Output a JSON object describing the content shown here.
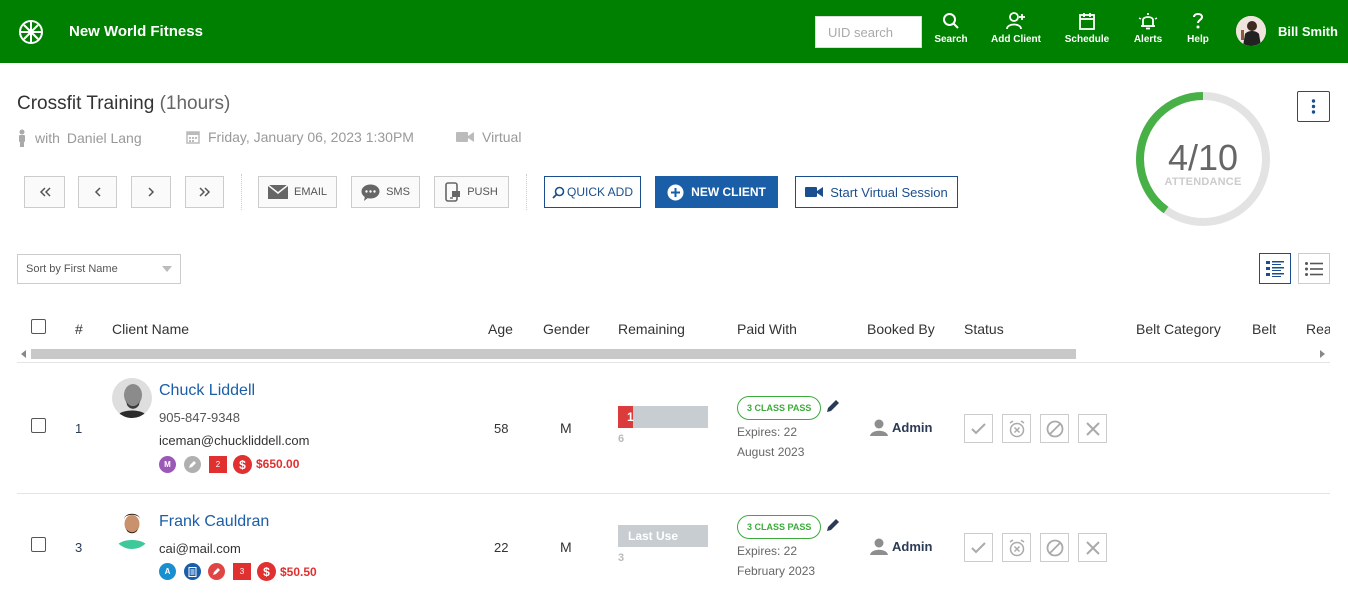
{
  "app": {
    "brand": "New World Fitness",
    "uid_search_placeholder": "UID search",
    "nav": [
      {
        "label": "Search",
        "icon": "search-icon"
      },
      {
        "label": "Add Client",
        "icon": "add-user-icon"
      },
      {
        "label": "Schedule",
        "icon": "calendar-icon"
      },
      {
        "label": "Alerts",
        "icon": "bell-icon"
      },
      {
        "label": "Help",
        "icon": "help-icon"
      }
    ],
    "user_name": "Bill Smith",
    "colors": {
      "topbar": "#008000",
      "primary": "#1a5ea8",
      "accent_green": "#3cab3c",
      "danger": "#e03030"
    }
  },
  "session": {
    "title": "Crossfit Training",
    "duration": "(1hours)",
    "instructor_prefix": "with",
    "instructor": "Daniel Lang",
    "datetime": "Friday, January 06, 2023 1:30PM",
    "location": "Virtual"
  },
  "attendance": {
    "display": "4/10",
    "label": "ATTENDANCE",
    "current": 4,
    "capacity": 10
  },
  "toolbar": {
    "email": "EMAIL",
    "sms": "SMS",
    "push": "PUSH",
    "quick_add": "QUICK ADD",
    "new_client": "NEW CLIENT",
    "start_virtual": "Start Virtual Session"
  },
  "sort": {
    "selected": "Sort by First Name"
  },
  "table": {
    "headers": {
      "number": "#",
      "client_name": "Client Name",
      "age": "Age",
      "gender": "Gender",
      "remaining": "Remaining",
      "paid_with": "Paid With",
      "booked_by": "Booked By",
      "status": "Status",
      "belt_category": "Belt Category",
      "belt": "Belt",
      "rea": "Rea"
    },
    "rows": [
      {
        "number": "1",
        "name": "Chuck Liddell",
        "phone": "905-847-9348",
        "email": "iceman@chuckliddell.com",
        "badges": [
          {
            "text": "M",
            "color": "#9b59b6"
          },
          {
            "icon": "pencil-icon",
            "color": "#b0b0b0"
          },
          {
            "text": "2",
            "square": true
          },
          {
            "icon": "dollar-icon",
            "color": "#e03030"
          }
        ],
        "balance": "$650.00",
        "age": "58",
        "gender": "M",
        "remaining_used": "1",
        "remaining_total": "6",
        "pass": "3 CLASS PASS",
        "expires_line1": "Expires: 22",
        "expires_line2": "August 2023",
        "booked_by": "Admin"
      },
      {
        "number": "3",
        "name": "Frank Cauldran",
        "email": "cai@mail.com",
        "badges": [
          {
            "text": "A",
            "color": "#1a8fd0"
          },
          {
            "icon": "document-icon",
            "color": "#1a5ea8"
          },
          {
            "icon": "pencil-icon",
            "color": "#e04545"
          },
          {
            "text": "3",
            "square": true
          },
          {
            "icon": "dollar-icon",
            "color": "#e03030"
          }
        ],
        "balance": "$50.50",
        "age": "22",
        "gender": "M",
        "remaining_label": "Last Use",
        "remaining_total": "3",
        "pass": "3 CLASS PASS",
        "expires_line1": "Expires: 22",
        "expires_line2": "February 2023",
        "booked_by": "Admin"
      }
    ]
  }
}
